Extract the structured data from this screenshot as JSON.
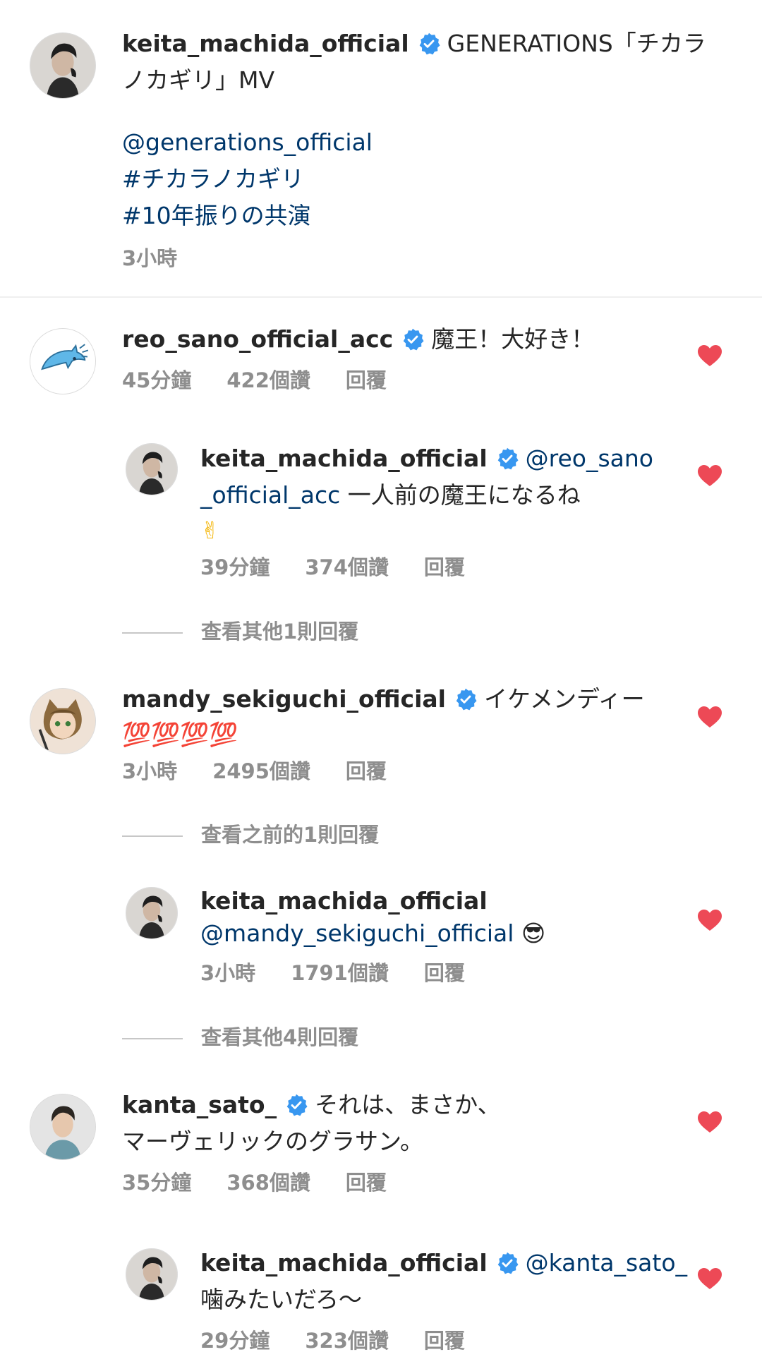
{
  "caption": {
    "username": "keita_machida_official",
    "text_1": "GENERATIONS「チカラ",
    "text_2": "ノカギリ」MV",
    "mention": "@generations_official",
    "hashtag_1": "#チカラノカギリ",
    "hashtag_2": "#10年振りの共演",
    "time": "3小時"
  },
  "comments": [
    {
      "username": "reo_sano_official_acc",
      "text": "魔王！大好き！",
      "time": "45分鐘",
      "likes": "422個讚",
      "reply": "回覆"
    },
    {
      "username": "keita_machida_official",
      "mention_1": "@reo_sano",
      "mention_2": "_official_acc",
      "text": " 一人前の魔王になるね",
      "emoji": "✌",
      "time": "39分鐘",
      "likes": "374個讚",
      "reply": "回覆"
    },
    {
      "username": "mandy_sekiguchi_official",
      "text": "イケメンディー",
      "emoji": "💯💯💯💯",
      "time": "3小時",
      "likes": "2495個讚",
      "reply": "回覆"
    },
    {
      "username": "keita_machida_official",
      "mention": "@mandy_sekiguchi_official",
      "emoji": "😎",
      "time": "3小時",
      "likes": "1791個讚",
      "reply": "回覆"
    },
    {
      "username": "kanta_sato_",
      "text_1": "それは、まさか、",
      "text_2": "マーヴェリックのグラサン。",
      "time": "35分鐘",
      "likes": "368個讚",
      "reply": "回覆"
    },
    {
      "username": "keita_machida_official",
      "mention": "@kanta_sato_",
      "text": "噛みたいだろ〜",
      "time": "29分鐘",
      "likes": "323個讚",
      "reply": "回覆"
    }
  ],
  "view_more": {
    "reo_other": "查看其他1則回覆",
    "mandy_previous": "查看之前的1則回覆",
    "mandy_other": "查看其他4則回覆"
  },
  "colors": {
    "heart": "#ed4956",
    "verified": "#3897f0",
    "link": "#00376b",
    "meta": "#8e8e8e"
  },
  "icons": [
    "verified-badge-icon",
    "heart-icon",
    "avatar"
  ]
}
